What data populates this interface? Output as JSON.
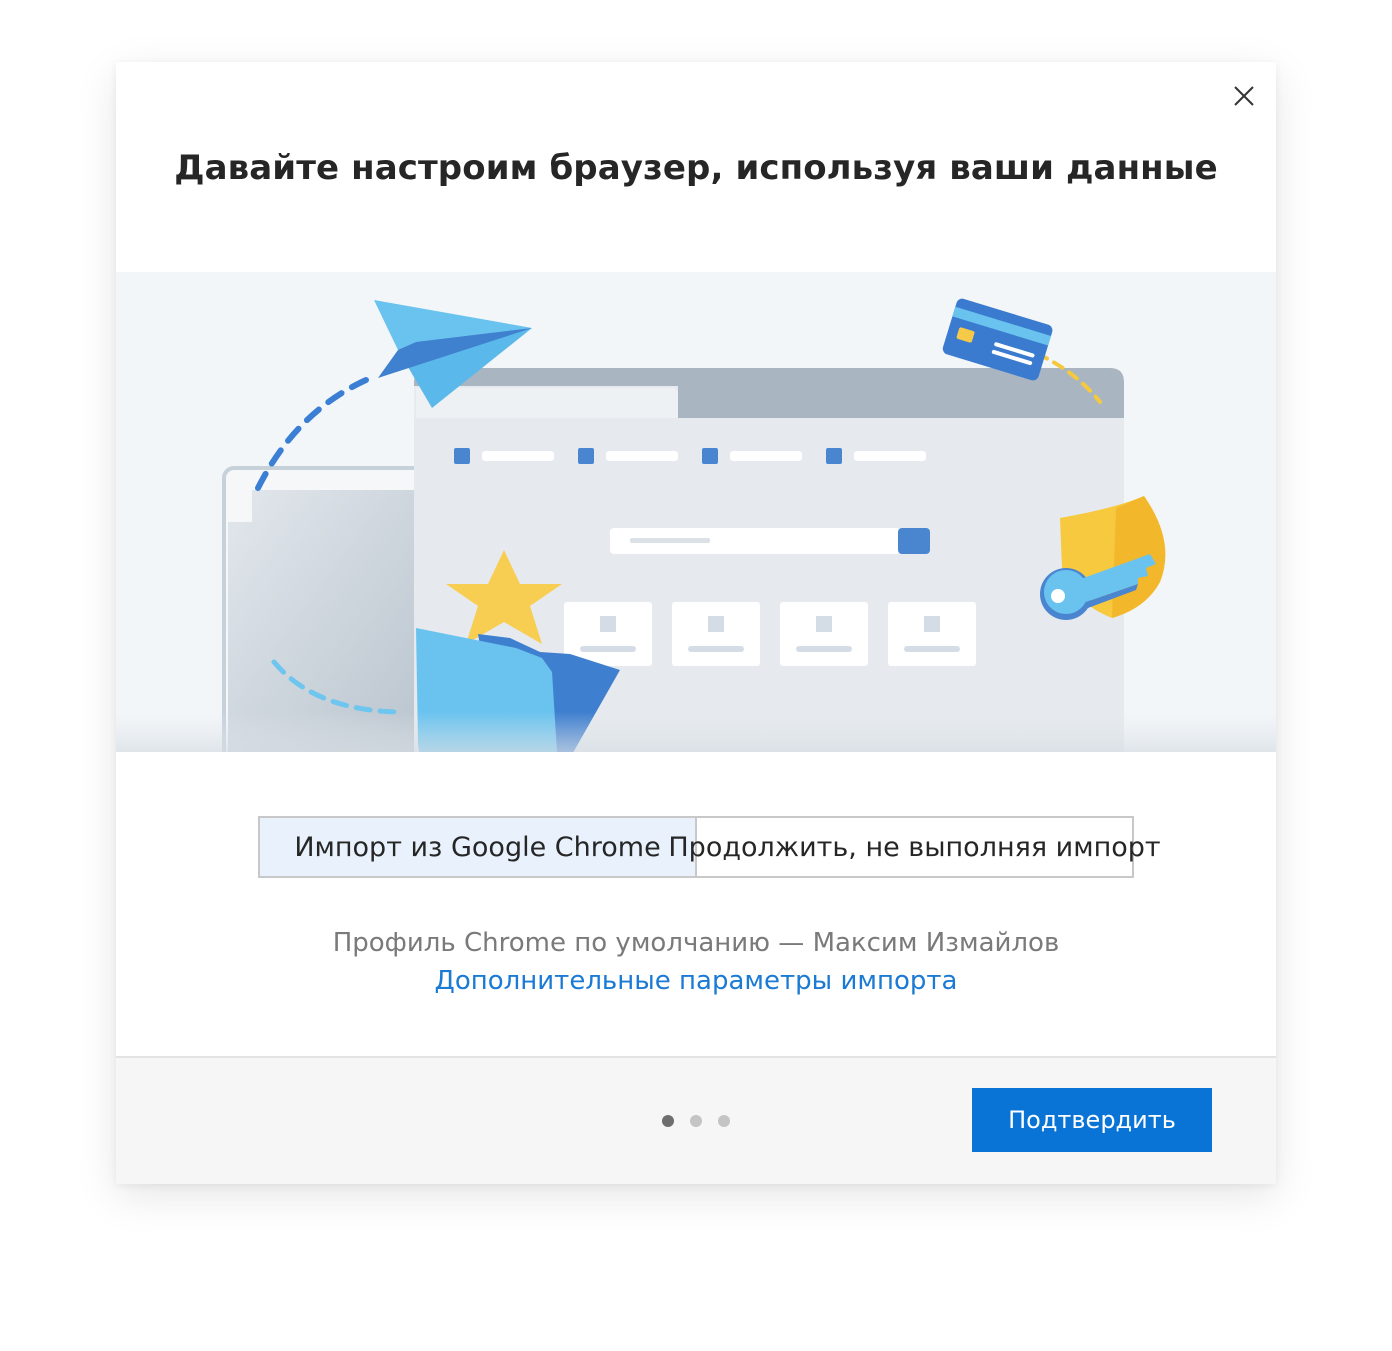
{
  "dialog": {
    "title": "Давайте настроим браузер, используя ваши данные",
    "close_icon": "close-icon"
  },
  "import_choice": {
    "options": [
      {
        "label": "Импорт из Google Chrome",
        "selected": true
      },
      {
        "label": "Продолжить, не выполняя импорт",
        "selected": false
      }
    ]
  },
  "profile_text": "Профиль Chrome по умолчанию — Максим Измайлов",
  "more_options_link": "Дополнительные параметры импорта",
  "pager": {
    "total": 3,
    "current": 1
  },
  "footer": {
    "confirm_label": "Подтвердить"
  },
  "colors": {
    "accent": "#0a74d6",
    "link": "#1a7ad4",
    "selected_bg": "#e9f2fc"
  },
  "illustration_icons": [
    "paper-plane-icon",
    "credit-card-icon",
    "browser-window-icon",
    "star-icon",
    "folder-icon",
    "shield-icon",
    "key-icon"
  ]
}
